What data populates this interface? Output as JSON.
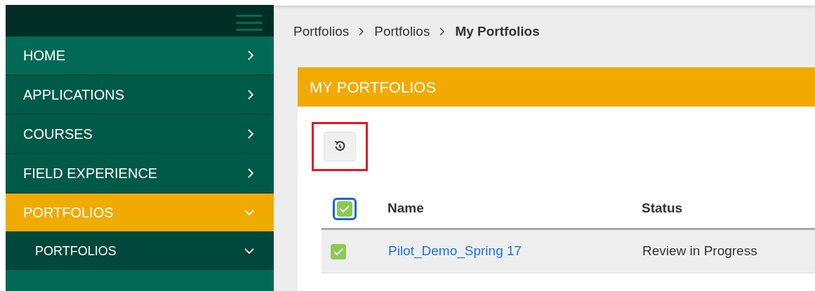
{
  "sidebar": {
    "items": [
      {
        "label": "HOME",
        "selected": false,
        "expanded": false,
        "highlighted": true
      },
      {
        "label": "APPLICATIONS",
        "selected": false,
        "expanded": false,
        "highlighted": false
      },
      {
        "label": "COURSES",
        "selected": false,
        "expanded": false,
        "highlighted": false
      },
      {
        "label": "FIELD EXPERIENCE",
        "selected": false,
        "expanded": false,
        "highlighted": false
      },
      {
        "label": "PORTFOLIOS",
        "selected": true,
        "expanded": true,
        "highlighted": false,
        "children": [
          {
            "label": "PORTFOLIOS",
            "expanded": true
          }
        ]
      }
    ]
  },
  "breadcrumb": [
    {
      "label": "Portfolios",
      "current": false
    },
    {
      "label": "Portfolios",
      "current": false
    },
    {
      "label": "My Portfolios",
      "current": true
    }
  ],
  "panel": {
    "title": "MY PORTFOLIOS",
    "table": {
      "select_all_checked": true,
      "columns": [
        "Name",
        "Status"
      ],
      "rows": [
        {
          "checked": true,
          "name": "Pilot_Demo_Spring 17",
          "status": "Review in Progress"
        }
      ]
    }
  }
}
